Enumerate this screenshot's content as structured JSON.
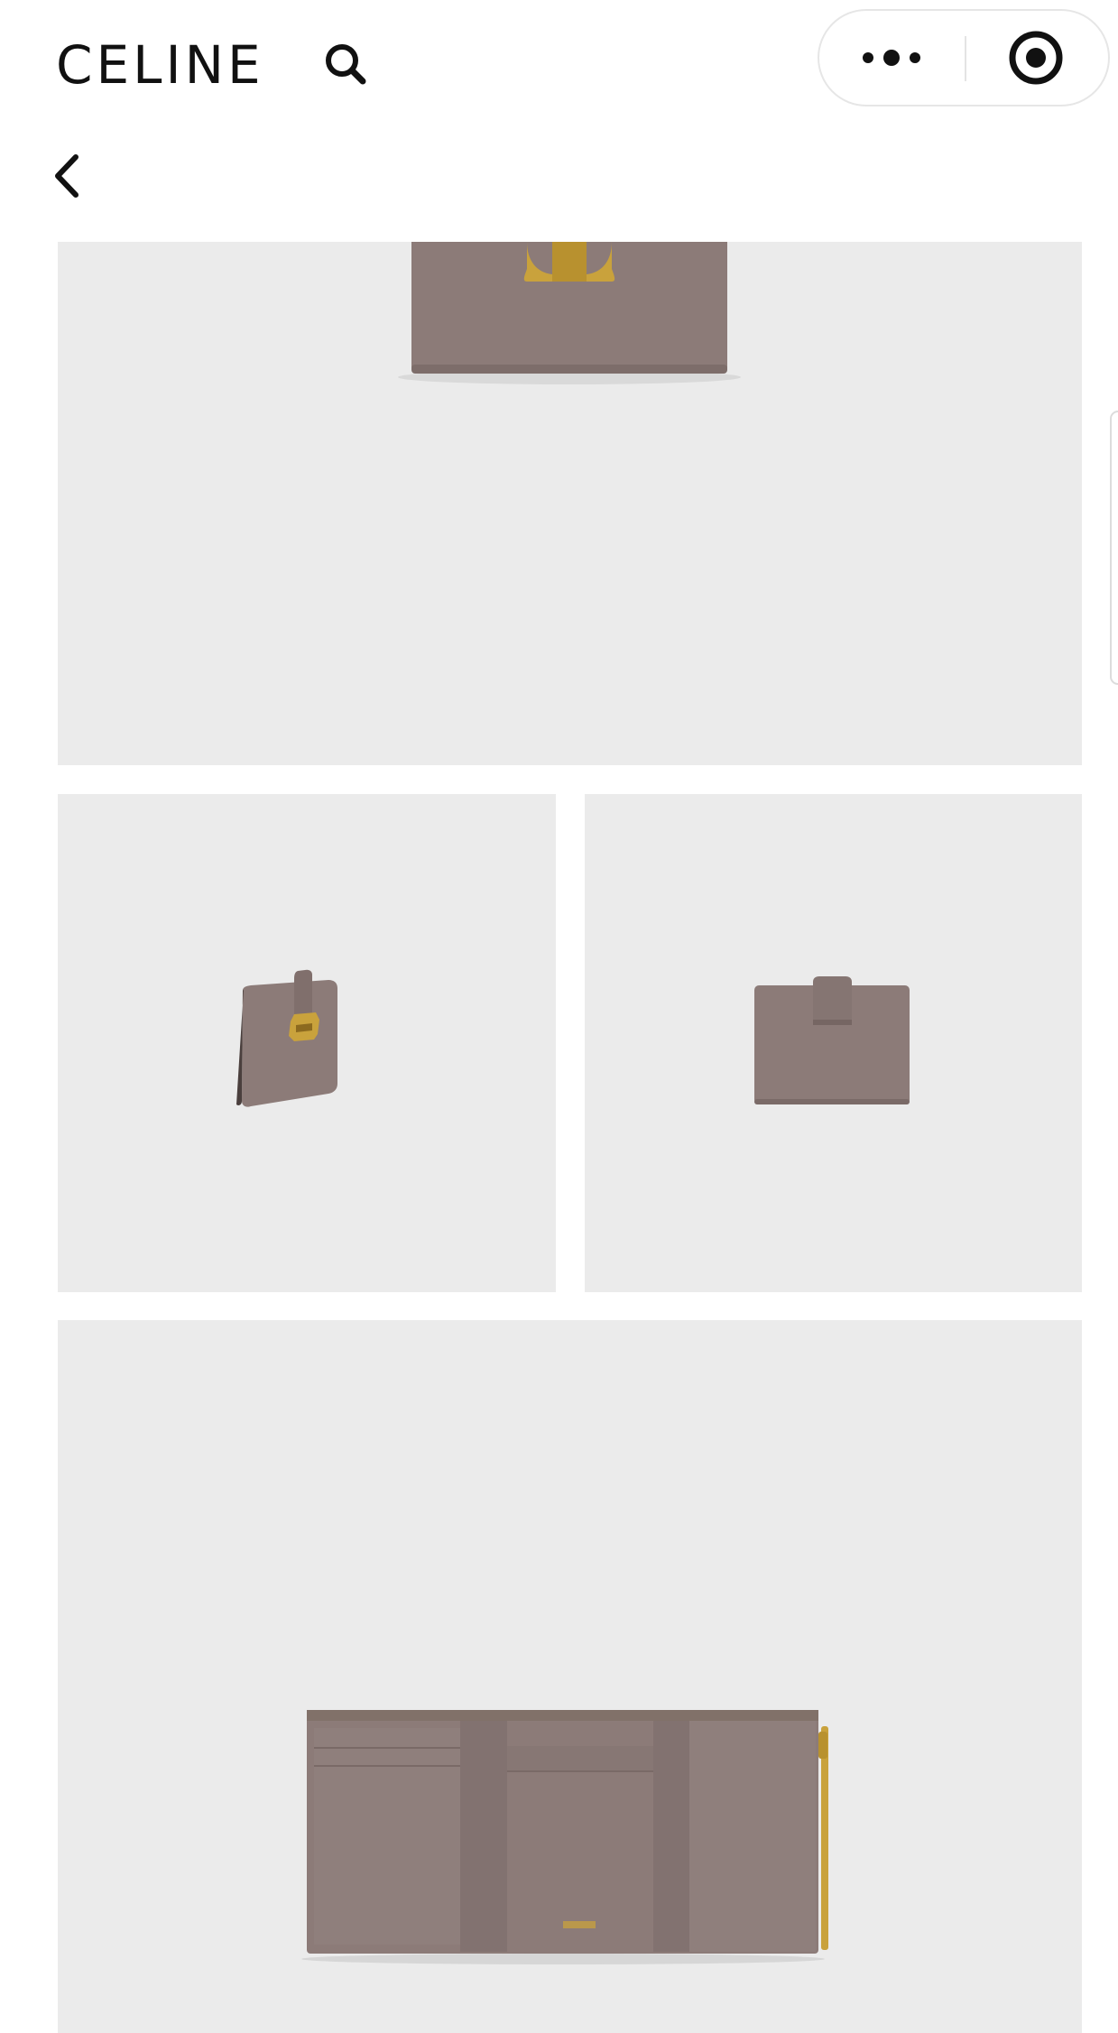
{
  "header": {
    "brand": "CELINE",
    "icons": {
      "search": "search-icon",
      "more": "more-dots-icon",
      "close": "target-circle-icon",
      "back": "chevron-left-icon"
    }
  },
  "gallery": {
    "images": [
      {
        "name": "wallet-front-view",
        "kind": "product-photo"
      },
      {
        "name": "wallet-side-view",
        "kind": "product-photo"
      },
      {
        "name": "wallet-back-view",
        "kind": "product-photo"
      },
      {
        "name": "wallet-open-view",
        "kind": "product-photo"
      }
    ]
  },
  "colors": {
    "background": "#ffffff",
    "tile": "#ebebeb",
    "leather": "#8c7b78",
    "leather_dark": "#7a6a67",
    "gold": "#c9a23c",
    "text": "#111111"
  }
}
